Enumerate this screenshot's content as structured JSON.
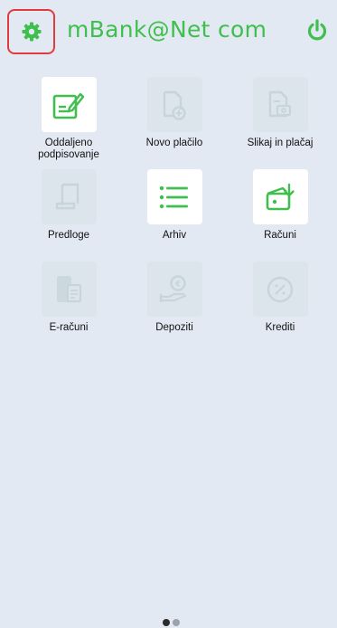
{
  "header": {
    "title": "mBank@Net com",
    "settings_icon": "gear-icon",
    "power_icon": "power-icon",
    "highlight_color": "#e23b3b",
    "accent_color": "#3fbf4d"
  },
  "menu": {
    "items": [
      {
        "label": "Oddaljeno\npodpisovanje",
        "icon": "sign-document-icon",
        "enabled": true
      },
      {
        "label": "Novo plačilo",
        "icon": "new-payment-icon",
        "enabled": false
      },
      {
        "label": "Slikaj in plačaj",
        "icon": "scan-and-pay-icon",
        "enabled": false
      },
      {
        "label": "Predloge",
        "icon": "templates-icon",
        "enabled": false
      },
      {
        "label": "Arhiv",
        "icon": "archive-list-icon",
        "enabled": true
      },
      {
        "label": "Računi",
        "icon": "accounts-wallet-icon",
        "enabled": true
      },
      {
        "label": "E-računi",
        "icon": "e-invoices-icon",
        "enabled": false
      },
      {
        "label": "Depoziti",
        "icon": "deposits-icon",
        "enabled": false
      },
      {
        "label": "Krediti",
        "icon": "loans-icon",
        "enabled": false
      }
    ]
  },
  "pager": {
    "page_count": 2,
    "current_page": 1
  }
}
